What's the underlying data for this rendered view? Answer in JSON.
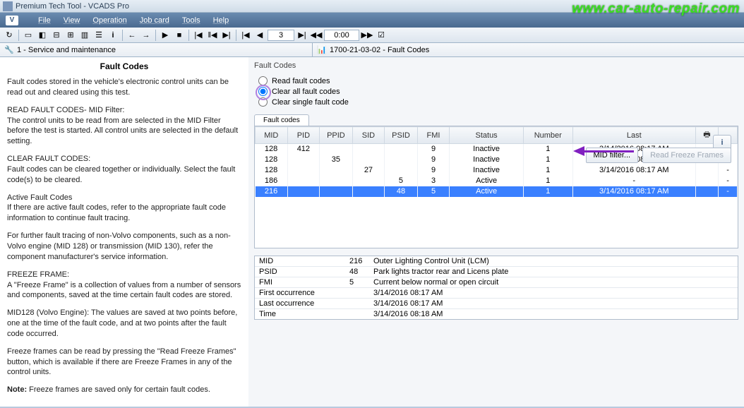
{
  "title": "Premium Tech Tool - VCADS Pro",
  "watermark": "www.car-auto-repair.com",
  "menu": {
    "logo": "V",
    "items": [
      "File",
      "View",
      "Operation",
      "Job card",
      "Tools",
      "Help"
    ]
  },
  "toolbar": {
    "page_input": "3",
    "time_input": "0:00"
  },
  "breadcrumbs": {
    "left": "1 - Service and maintenance",
    "right": "1700-21-03-02 - Fault Codes"
  },
  "left": {
    "heading": "Fault Codes",
    "p1": "Fault codes stored in the vehicle's electronic control units can be read out and cleared using this test.",
    "p2a": "READ FAULT CODES- MID Filter:",
    "p2b": "The control units to be read from are selected in the MID Filter before the test is started. All control units are selected in the default setting.",
    "p3a": "CLEAR FAULT CODES:",
    "p3b": "Fault codes can be cleared together or individually. Select the fault code(s) to be cleared.",
    "p4a": "Active Fault Codes",
    "p4b": "If there are active fault codes, refer to the appropriate fault code information to continue fault tracing.",
    "p5": "For further fault tracing of non-Volvo components, such as a non-Volvo engine (MID 128) or transmission (MID 130), refer the component manufacturer's service information.",
    "p6a": "FREEZE FRAME:",
    "p6b": "A \"Freeze Frame\" is a collection of values from a number of sensors and components, saved at the time certain fault codes are stored.",
    "p7": "MID128 (Volvo Engine): The values are saved at two points before, one at the time of the fault code, and at two points after the fault code occurred.",
    "p8": "Freeze frames can be read by pressing the \"Read Freeze Frames\" button, which is available if there are Freeze Frames in any of the control units.",
    "p9a": "Note:",
    "p9b": " Freeze frames are saved only for certain fault codes."
  },
  "right": {
    "panel_title": "Fault Codes",
    "radios": {
      "read": "Read fault codes",
      "clear_all": "Clear all fault codes",
      "clear_single": "Clear single fault code"
    },
    "buttons": {
      "mid_filter": "MID filter...",
      "read_freeze": "Read Freeze Frames",
      "info": "i"
    },
    "tab": "Fault codes",
    "headers": {
      "mid": "MID",
      "pid": "PID",
      "ppid": "PPID",
      "sid": "SID",
      "psid": "PSID",
      "fmi": "FMI",
      "status": "Status",
      "number": "Number",
      "last": "Last"
    },
    "rows": [
      {
        "mid": "128",
        "pid": "412",
        "ppid": "",
        "sid": "",
        "psid": "",
        "fmi": "9",
        "status": "Inactive",
        "number": "1",
        "last": "3/14/2016  08:17 AM",
        "dash": "-"
      },
      {
        "mid": "128",
        "pid": "",
        "ppid": "35",
        "sid": "",
        "psid": "",
        "fmi": "9",
        "status": "Inactive",
        "number": "1",
        "last": "3/14/2016  08:17 AM",
        "dash": "-"
      },
      {
        "mid": "128",
        "pid": "",
        "ppid": "",
        "sid": "27",
        "psid": "",
        "fmi": "9",
        "status": "Inactive",
        "number": "1",
        "last": "3/14/2016  08:17 AM",
        "dash": "-"
      },
      {
        "mid": "186",
        "pid": "",
        "ppid": "",
        "sid": "",
        "psid": "5",
        "fmi": "3",
        "status": "Active",
        "number": "1",
        "last": "-",
        "dash": "-"
      },
      {
        "mid": "216",
        "pid": "",
        "ppid": "",
        "sid": "",
        "psid": "48",
        "fmi": "5",
        "status": "Active",
        "number": "1",
        "last": "3/14/2016  08:17 AM",
        "dash": "-",
        "selected": true
      }
    ],
    "details": [
      {
        "k": "MID",
        "v1": "216",
        "v2": "Outer Lighting Control Unit (LCM)"
      },
      {
        "k": "PSID",
        "v1": "48",
        "v2": "Park lights tractor rear and Licens plate"
      },
      {
        "k": "FMI",
        "v1": "5",
        "v2": "Current below normal or open circuit"
      },
      {
        "k": "First occurrence",
        "v1": "",
        "v2": "3/14/2016  08:17 AM"
      },
      {
        "k": "Last occurrence",
        "v1": "",
        "v2": "3/14/2016  08:17 AM"
      },
      {
        "k": "Time",
        "v1": "",
        "v2": "3/14/2016  08:18 AM"
      }
    ]
  }
}
